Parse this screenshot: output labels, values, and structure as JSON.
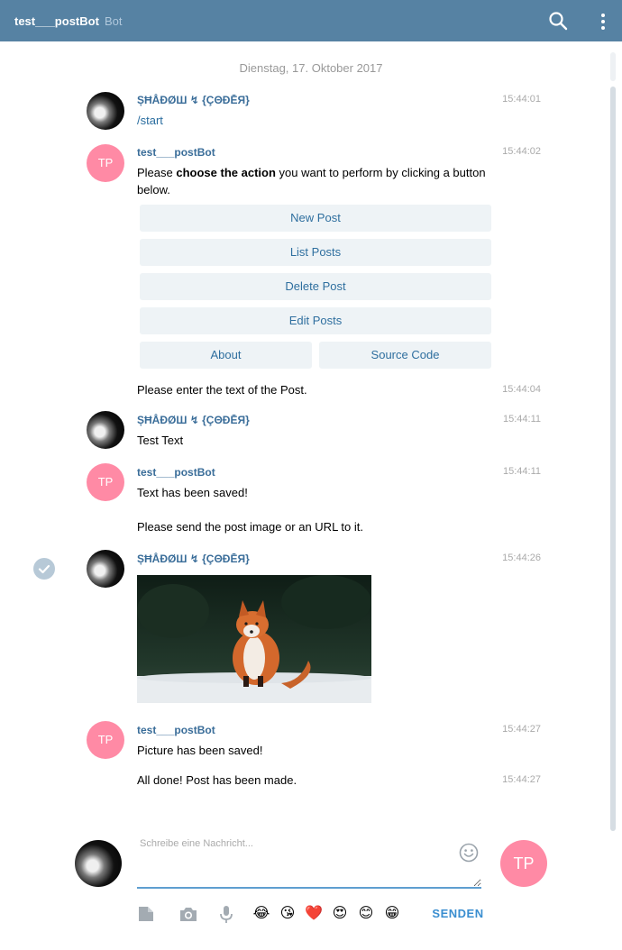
{
  "header": {
    "title": "test___postBot",
    "subtitle": "Bot"
  },
  "date_separator": "Dienstag, 17. Oktober 2017",
  "messages": [
    {
      "author": "ȘĦÅĐØШ ↯ {ÇΘĐĒЯ}",
      "time": "15:44:01",
      "text": "/start"
    },
    {
      "author": "test___postBot",
      "time": "15:44:02",
      "avatar": "TP",
      "text_pre": "Please ",
      "text_bold": "choose the action",
      "text_post": " you want to perform by clicking a button below."
    },
    {
      "time": "15:44:04",
      "text": "Please enter the text of the Post."
    },
    {
      "author": "ȘĦÅĐØШ ↯ {ÇΘĐĒЯ}",
      "time": "15:44:11",
      "text": "Test Text"
    },
    {
      "author": "test___postBot",
      "time": "15:44:11",
      "avatar": "TP",
      "text": "Text has been saved!",
      "text2": "Please send the post image or an URL to it."
    },
    {
      "author": "ȘĦÅĐØШ ↯ {ÇΘĐĒЯ}",
      "time": "15:44:26"
    },
    {
      "author": "test___postBot",
      "time": "15:44:27",
      "avatar": "TP",
      "text": "Picture has been saved!"
    },
    {
      "time": "15:44:27",
      "text": "All done! Post has been made."
    }
  ],
  "keyboard": {
    "new_post": "New Post",
    "list_posts": "List Posts",
    "delete_post": "Delete Post",
    "edit_posts": "Edit Posts",
    "about": "About",
    "source_code": "Source Code"
  },
  "composer": {
    "placeholder": "Schreibe eine Nachricht...",
    "send_label": "SENDEN",
    "peer_avatar": "TP",
    "emojis": [
      "😂",
      "😘",
      "❤️",
      "😍",
      "😊",
      "😁"
    ]
  },
  "colors": {
    "header": "#5682a3",
    "author": "#3a6d99",
    "bot_avatar": "#ff8aa5",
    "button_text": "#2f6f9f",
    "accent": "#3a8ed0"
  },
  "icons": [
    "search-icon",
    "more-vertical-icon",
    "check-icon",
    "smile-icon",
    "file-icon",
    "camera-icon",
    "microphone-icon"
  ]
}
